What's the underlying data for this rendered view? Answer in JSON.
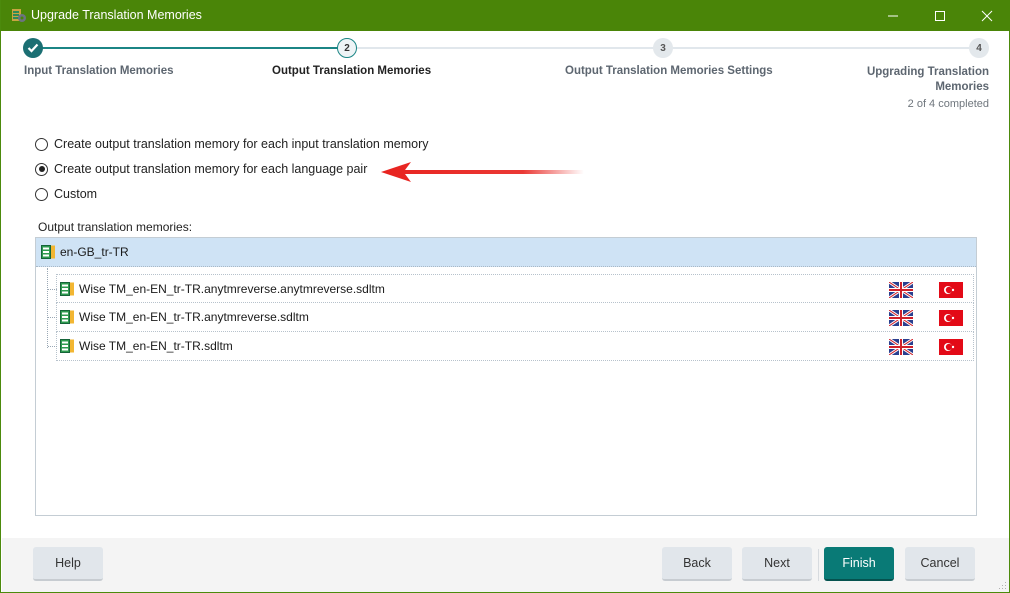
{
  "window": {
    "title": "Upgrade Translation Memories",
    "controls": {
      "minimize": "minimize",
      "maximize": "maximize",
      "close": "close"
    }
  },
  "stepper": {
    "steps": [
      {
        "number": "1",
        "label": "Input Translation Memories",
        "state": "completed"
      },
      {
        "number": "2",
        "label": "Output Translation Memories",
        "state": "current"
      },
      {
        "number": "3",
        "label": "Output Translation Memories Settings",
        "state": "pending"
      },
      {
        "number": "4",
        "label": "Upgrading Translation Memories",
        "state": "pending"
      }
    ],
    "progress_text": "2 of 4 completed",
    "completed": 2,
    "total": 4
  },
  "options": {
    "items": [
      {
        "label": "Create output translation memory for each input translation memory",
        "checked": false
      },
      {
        "label": "Create output translation memory for each language pair",
        "checked": true
      },
      {
        "label": "Custom",
        "checked": false
      }
    ]
  },
  "annotation": {
    "arrow_color": "#e8231f"
  },
  "output_tms": {
    "label": "Output translation memories:",
    "group": {
      "name": "en-GB_tr-TR",
      "items": [
        {
          "name": "Wise TM_en-EN_tr-TR.anytmreverse.anytmreverse.sdltm",
          "source_flag": "uk-flag",
          "target_flag": "turkey-flag"
        },
        {
          "name": "Wise TM_en-EN_tr-TR.anytmreverse.sdltm",
          "source_flag": "uk-flag",
          "target_flag": "turkey-flag"
        },
        {
          "name": "Wise TM_en-EN_tr-TR.sdltm",
          "source_flag": "uk-flag",
          "target_flag": "turkey-flag"
        }
      ]
    }
  },
  "footer": {
    "help": "Help",
    "back": "Back",
    "next": "Next",
    "finish": "Finish",
    "cancel": "Cancel"
  },
  "colors": {
    "titlebar": "#4a8508",
    "accent_teal": "#097a76",
    "selected_row": "#cfe3f5"
  }
}
